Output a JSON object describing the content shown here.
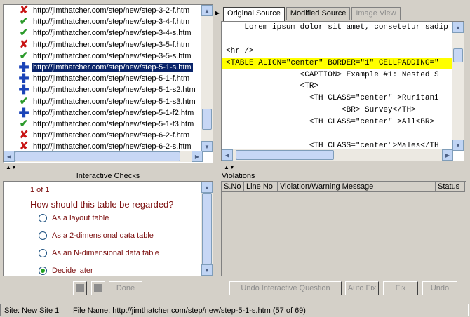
{
  "files": [
    {
      "status": "fail",
      "name": "http://jimthatcher.com/step/new/step-3-2-f.htm"
    },
    {
      "status": "pass",
      "name": "http://jimthatcher.com/step/new/step-3-4-f.htm"
    },
    {
      "status": "pass",
      "name": "http://jimthatcher.com/step/new/step-3-4-s.htm"
    },
    {
      "status": "fail",
      "name": "http://jimthatcher.com/step/new/step-3-5-f.htm"
    },
    {
      "status": "pass",
      "name": "http://jimthatcher.com/step/new/step-3-5-s.htm"
    },
    {
      "status": "check",
      "name": "http://jimthatcher.com/step/new/step-5-1-s.htm",
      "selected": true
    },
    {
      "status": "check",
      "name": "http://jimthatcher.com/step/new/step-5-1-f.htm"
    },
    {
      "status": "check",
      "name": "http://jimthatcher.com/step/new/step-5-1-s2.htm"
    },
    {
      "status": "pass",
      "name": "http://jimthatcher.com/step/new/step-5-1-s3.htm"
    },
    {
      "status": "check",
      "name": "http://jimthatcher.com/step/new/step-5-1-f2.htm"
    },
    {
      "status": "pass",
      "name": "http://jimthatcher.com/step/new/step-5-1-f3.htm"
    },
    {
      "status": "fail",
      "name": "http://jimthatcher.com/step/new/step-6-2-f.htm"
    },
    {
      "status": "fail",
      "name": "http://jimthatcher.com/step/new/step-6-2-s.htm"
    }
  ],
  "icons": {
    "fail": "red-x-icon",
    "pass": "green-check-icon",
    "check": "blue-plus-icon"
  },
  "tabs": [
    {
      "label": "Original Source",
      "state": "active"
    },
    {
      "label": "Modified Source",
      "state": "normal"
    },
    {
      "label": "Image View",
      "state": "disabled"
    }
  ],
  "source_lines": [
    {
      "text": "    Lorem ipsum dolor sit amet, consetetur sadip"
    },
    {
      "text": ""
    },
    {
      "text": "<hr />"
    },
    {
      "text": "<TABLE ALIGN=\"center\" BORDER=\"1\" CELLPADDING=\"",
      "highlight": true
    },
    {
      "text": "                <CAPTION> Example #1: Nested S"
    },
    {
      "text": "                <TR>"
    },
    {
      "text": "                  <TH CLASS=\"center\" >Ruritani"
    },
    {
      "text": "                         <BR> Survey</TH>"
    },
    {
      "text": "                  <TH CLASS=\"center\" >All<BR>"
    },
    {
      "text": ""
    },
    {
      "text": "                  <TH CLASS=\"center\">Males</TH"
    }
  ],
  "interactive_checks": {
    "title": "Interactive Checks",
    "counter": "1 of 1",
    "question": "How should this table be regarded?",
    "options": [
      {
        "label": "As a layout table",
        "checked": false
      },
      {
        "label": "As a 2-dimensional data table",
        "checked": false
      },
      {
        "label": "As an N-dimensional data table",
        "checked": false
      },
      {
        "label": "Decide later",
        "checked": true
      }
    ],
    "done_label": "Done"
  },
  "violations": {
    "title": "Violations",
    "columns": [
      "S.No",
      "Line No",
      "Violation/Warning Message",
      "Status"
    ]
  },
  "buttons": {
    "undo_interactive": "Undo Interactive Question",
    "auto_fix": "Auto Fix",
    "fix": "Fix",
    "undo": "Undo"
  },
  "status_bar": {
    "site": "Site: New Site 1",
    "file": "File Name: http://jimthatcher.com/step/new/step-5-1-s.htm (57 of 69)"
  }
}
